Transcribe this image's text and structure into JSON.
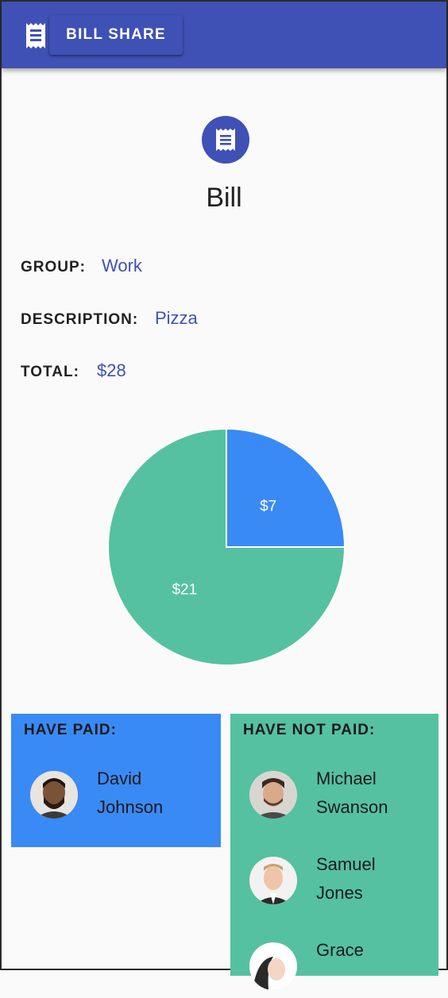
{
  "appbar": {
    "title": "BILL SHARE",
    "menu_icon": "receipt-icon",
    "color": "#3f51b5"
  },
  "bill": {
    "icon": "receipt-icon",
    "title": "Bill",
    "fields": [
      {
        "label": "GROUP:",
        "value": "Work"
      },
      {
        "label": "DESCRIPTION:",
        "value": "Pizza"
      },
      {
        "label": "TOTAL:",
        "value": "$28"
      }
    ]
  },
  "chart_data": {
    "type": "pie",
    "title": "",
    "slices": [
      {
        "label": "$7",
        "value": 7,
        "color": "#3a8af5"
      },
      {
        "label": "$21",
        "value": 21,
        "color": "#55c1a0"
      }
    ],
    "start_angle": "12 o'clock, clockwise"
  },
  "have_paid": {
    "heading": "HAVE PAID:",
    "color": "#3a8af5",
    "people": [
      {
        "first": "David",
        "last": "Johnson"
      }
    ]
  },
  "have_not_paid": {
    "heading": "HAVE NOT PAID:",
    "color": "#55c1a0",
    "people": [
      {
        "first": "Michael",
        "last": "Swanson"
      },
      {
        "first": "Samuel",
        "last": "Jones"
      },
      {
        "first": "Grace",
        "last": ""
      }
    ]
  }
}
